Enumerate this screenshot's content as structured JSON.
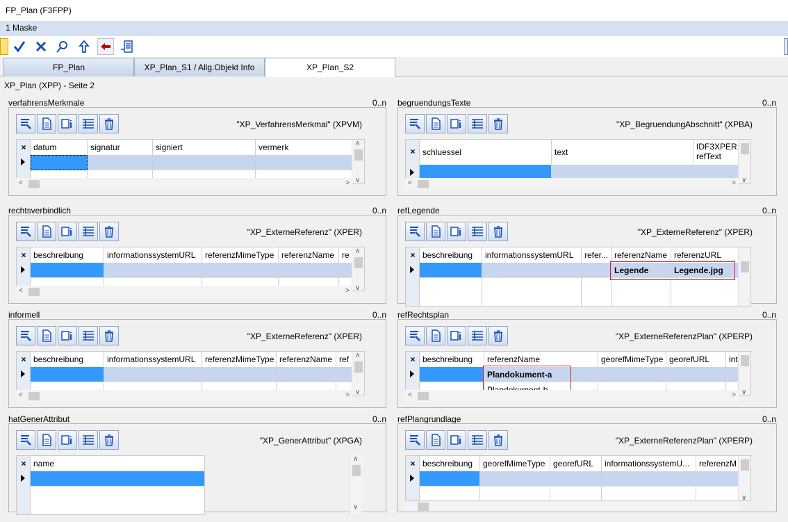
{
  "window": {
    "title": "FP_Plan (F3FPP)"
  },
  "menu": {
    "label": "1 Maske"
  },
  "toolbar": {
    "icons": [
      "yellow-arrow-icon",
      "checkmark-icon",
      "cancel-x-icon",
      "search-map-icon",
      "up-arrow-icon",
      "red-back-arrow-icon",
      "export-list-icon"
    ]
  },
  "tabs": [
    {
      "label": "FP_Plan"
    },
    {
      "label": "XP_Plan_S1 / Allg.Objekt Info"
    },
    {
      "label": "XP_Plan_S2"
    }
  ],
  "page": {
    "label": "XP_Plan (XPP) - Seite 2"
  },
  "common": {
    "card": "0..n"
  },
  "panels": {
    "verfahrensMerkmale": {
      "label": "verfahrensMerkmale",
      "type": "\"XP_VerfahrensMerkmal\" (XPVM)",
      "columns": [
        "datum",
        "signatur",
        "signiert",
        "vermerk"
      ]
    },
    "begruendungsTexte": {
      "label": "begruendungsTexte",
      "type": "\"XP_BegruendungAbschnitt\" (XPBA)",
      "columns": [
        "schluessel",
        "text",
        "IDF3XPER",
        "refText"
      ]
    },
    "rechtsverbindlich": {
      "label": "rechtsverbindlich",
      "type": "\"XP_ExterneReferenz\" (XPER)",
      "columns": [
        "beschreibung",
        "informationssystemURL",
        "referenzMimeType",
        "referenzName",
        "re"
      ]
    },
    "refLegende": {
      "label": "refLegende",
      "type": "\"XP_ExterneReferenz\" (XPER)",
      "columns": [
        "beschreibung",
        "informationssystemURL",
        "refer...",
        "referenzName",
        "referenzURL"
      ],
      "rows": [
        {
          "referenzName": "Legende",
          "referenzURL": "Legende.jpg"
        }
      ]
    },
    "informell": {
      "label": "informell",
      "type": "\"XP_ExterneReferenz\" (XPER)",
      "columns": [
        "beschreibung",
        "informationssystemURL",
        "referenzMimeType",
        "referenzName",
        "ref"
      ]
    },
    "refRechtsplan": {
      "label": "refRechtsplan",
      "type": "\"XP_ExterneReferenzPlan\" (XPERP)",
      "columns": [
        "beschreibung",
        "referenzName",
        "georefMimeType",
        "georefURL",
        "int"
      ],
      "rows": [
        {
          "referenzName": "Plandokument-a"
        },
        {
          "referenzName": "Plandokument-b"
        }
      ]
    },
    "hatGenerAttribut": {
      "label": "hatGenerAttribut",
      "type": "\"XP_GenerAttribut\" (XPGA)",
      "columns": [
        "name"
      ]
    },
    "refPlangrundlage": {
      "label": "refPlangrundlage",
      "type": "\"XP_ExterneReferenzPlan\" (XPERP)",
      "columns": [
        "beschreibung",
        "georefMimeType",
        "georefURL",
        "informationssystemU...",
        "referenzM"
      ]
    }
  },
  "colors": {
    "accent": "#3399ff",
    "selectedRow": "#c7d6ee",
    "highlight": "#d02020",
    "menubar": "#d6e2f2"
  }
}
